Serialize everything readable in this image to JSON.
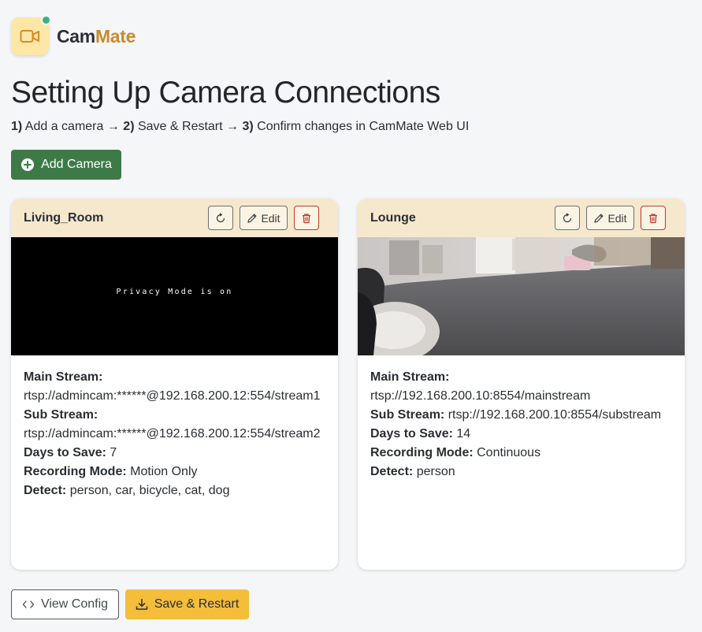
{
  "brand": {
    "part1": "Cam",
    "part2": "Mate"
  },
  "page": {
    "title": "Setting Up Camera Connections",
    "steps": [
      {
        "num": "1)",
        "text": " Add a camera → "
      },
      {
        "num": "2)",
        "text": " Save & Restart → "
      },
      {
        "num": "3)",
        "text": " Confirm changes in CamMate Web UI"
      }
    ]
  },
  "add_camera_label": "Add Camera",
  "cameras": [
    {
      "name": "Living_Room",
      "edit_label": "Edit",
      "overlay_text": "Privacy Mode is on",
      "main_stream_label": "Main Stream:",
      "main_stream": "rtsp://admincam:******@192.168.200.12:554/stream1",
      "sub_stream_label": "Sub Stream:",
      "sub_stream": "rtsp://admincam:******@192.168.200.12:554/stream2",
      "days_label": "Days to Save:",
      "days": "7",
      "mode_label": "Recording Mode:",
      "mode": "Motion Only",
      "detect_label": "Detect:",
      "detect": "person, car, bicycle, cat, dog"
    },
    {
      "name": "Lounge",
      "edit_label": "Edit",
      "main_stream_label": "Main Stream:",
      "main_stream": "rtsp://192.168.200.10:8554/mainstream",
      "sub_stream_label": "Sub Stream:",
      "sub_stream": "rtsp://192.168.200.10:8554/substream",
      "days_label": "Days to Save:",
      "days": "14",
      "mode_label": "Recording Mode:",
      "mode": "Continuous",
      "detect_label": "Detect:",
      "detect": "person"
    }
  ],
  "footer": {
    "view_config_label": "View Config",
    "save_restart_label": "Save & Restart"
  },
  "icons": {
    "logo": "video-camera-icon",
    "add": "plus-circle-icon",
    "refresh": "refresh-icon",
    "edit": "pencil-icon",
    "delete": "trash-icon",
    "code": "code-icon",
    "download": "download-icon"
  },
  "colors": {
    "primary_green": "#3d7a48",
    "accent_yellow": "#f4bd3a",
    "card_header": "#f6e8cd",
    "brand_orange": "#c98a2c",
    "status_dot": "#3bb37a",
    "delete_red": "#c0392b"
  }
}
